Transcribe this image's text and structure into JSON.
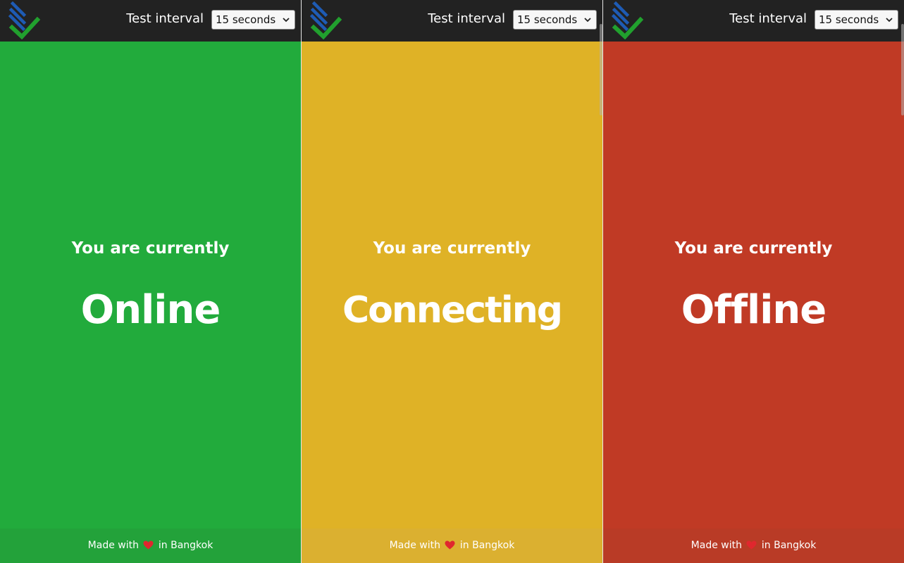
{
  "colors": {
    "topbar": "#222222",
    "online": "#22AB3C",
    "online_footer": "#23A23A",
    "connecting": "#DFB226",
    "connecting_footer": "#DBB030",
    "offline": "#C03A25",
    "offline_footer": "#B93B26",
    "logo_blue": "#1E5BB4",
    "logo_green": "#21A02E",
    "heart": "#E0272E"
  },
  "panels": [
    {
      "topbar": {
        "logo_icon": "stacked-check-logo-icon",
        "interval_label": "Test interval",
        "interval_value": "15 seconds",
        "dropdown_icon": "chevron-down-icon"
      },
      "intro": "You are currently",
      "status": "Online",
      "footer": {
        "prefix": "Made with",
        "heart_icon": "heart-icon",
        "suffix": "in Bangkok"
      }
    },
    {
      "topbar": {
        "logo_icon": "stacked-check-logo-icon",
        "interval_label": "Test interval",
        "interval_value": "15 seconds",
        "dropdown_icon": "chevron-down-icon"
      },
      "intro": "You are currently",
      "status": "Connecting",
      "footer": {
        "prefix": "Made with",
        "heart_icon": "heart-icon",
        "suffix": "in Bangkok"
      }
    },
    {
      "topbar": {
        "logo_icon": "stacked-check-logo-icon",
        "interval_label": "Test interval",
        "interval_value": "15 seconds",
        "dropdown_icon": "chevron-down-icon"
      },
      "intro": "You are currently",
      "status": "Offline",
      "footer": {
        "prefix": "Made with",
        "heart_icon": "heart-icon",
        "suffix": "in Bangkok"
      }
    }
  ]
}
